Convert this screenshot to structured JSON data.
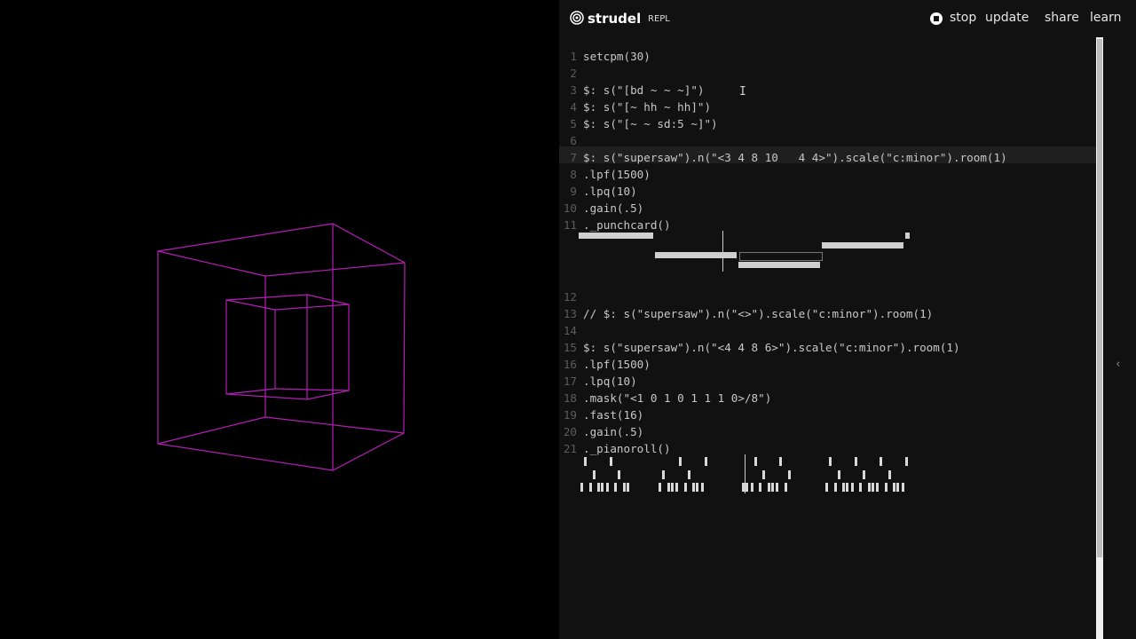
{
  "header": {
    "brand": "strudel",
    "brand_sub": "REPL",
    "stop_label": "stop",
    "update_label": "update",
    "share_label": "share",
    "learn_label": "learn",
    "collapse_icon": "‹"
  },
  "viz": {
    "cube_color": "#c020c0",
    "background": "#000000"
  },
  "editor": {
    "lines": [
      {
        "n": "1",
        "code": "setcpm(30)"
      },
      {
        "n": "2",
        "code": ""
      },
      {
        "n": "3",
        "code": "$: s(\"[bd ~ ~ ~]\")"
      },
      {
        "n": "4",
        "code": "$: s(\"[~ hh ~ hh]\")"
      },
      {
        "n": "5",
        "code": "$: s(\"[~ ~ sd:5 ~]\")"
      },
      {
        "n": "6",
        "code": ""
      },
      {
        "n": "7",
        "code": "$: s(\"supersaw\").n(\"<3 4 8 10   4 4>\").scale(\"c:minor\").room(1)"
      },
      {
        "n": "8",
        "code": ".lpf(1500)"
      },
      {
        "n": "9",
        "code": ".lpq(10)"
      },
      {
        "n": "10",
        "code": ".gain(.5)"
      },
      {
        "n": "11",
        "code": "._punchcard()"
      },
      {
        "n": "12",
        "code": ""
      },
      {
        "n": "13",
        "code": "// $: s(\"supersaw\").n(\"<>\").scale(\"c:minor\").room(1)"
      },
      {
        "n": "14",
        "code": ""
      },
      {
        "n": "15",
        "code": "$: s(\"supersaw\").n(\"<4 4 8 6>\").scale(\"c:minor\").room(1)"
      },
      {
        "n": "16",
        "code": ".lpf(1500)"
      },
      {
        "n": "17",
        "code": ".lpq(10)"
      },
      {
        "n": "18",
        "code": ".mask(\"<1 0 1 0 1 1 1 0>/8\")"
      },
      {
        "n": "19",
        "code": ".fast(16)"
      },
      {
        "n": "20",
        "code": ".gain(.5)"
      },
      {
        "n": "21",
        "code": "._pianoroll()"
      }
    ]
  },
  "punchcard": {
    "bars": [
      {
        "start": 0.0,
        "end": 0.23,
        "lane": 0
      },
      {
        "start": 0.23,
        "end": 0.48,
        "lane": 2
      },
      {
        "start": 0.48,
        "end": 0.73,
        "lane": 3
      },
      {
        "start": 0.73,
        "end": 0.98,
        "lane": 1
      },
      {
        "start": 0.98,
        "end": 1.0,
        "lane": 0
      }
    ],
    "playhead": 0.5
  },
  "pianoroll": {
    "playhead": 0.5
  }
}
